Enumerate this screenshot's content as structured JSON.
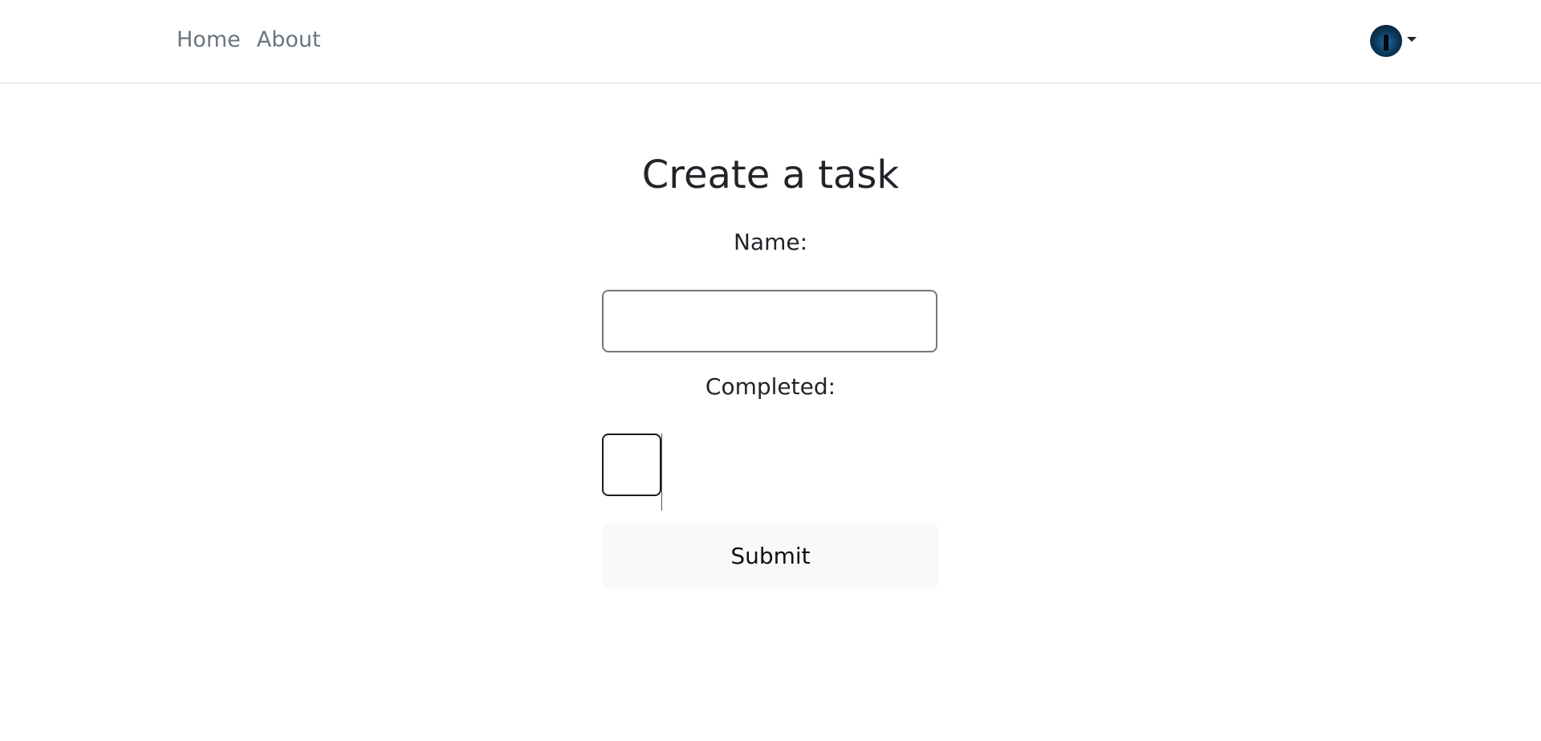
{
  "nav": {
    "links": [
      "Home",
      "About"
    ]
  },
  "user_menu": {
    "avatar_icon": "user-avatar-icon",
    "caret_icon": "caret-down-icon"
  },
  "form": {
    "title": "Create a task",
    "name_label": "Name:",
    "name_value": "",
    "completed_label": "Completed:",
    "completed_checked": false,
    "submit_label": "Submit"
  },
  "colors": {
    "nav_link": "#6c757d",
    "text": "#212529",
    "divider": "#dee2e6",
    "button_bg": "#f8f9fa"
  }
}
